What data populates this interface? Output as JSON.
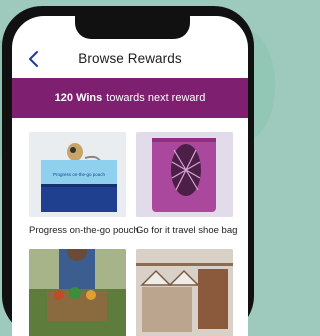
{
  "header": {
    "title": "Browse Rewards",
    "back_icon": "chevron-left-icon"
  },
  "banner": {
    "wins": "120 Wins",
    "text": "towards next reward"
  },
  "rewards": [
    {
      "label": "Progress on-the-go pouch",
      "pouch_text": "Progress on-the-go pouch"
    },
    {
      "label": "Go for it travel shoe bag"
    },
    {
      "label": ""
    },
    {
      "label": ""
    }
  ],
  "colors": {
    "accent": "#7e1f6f",
    "back": "#1f3a93",
    "background": "#9ec9bd"
  }
}
